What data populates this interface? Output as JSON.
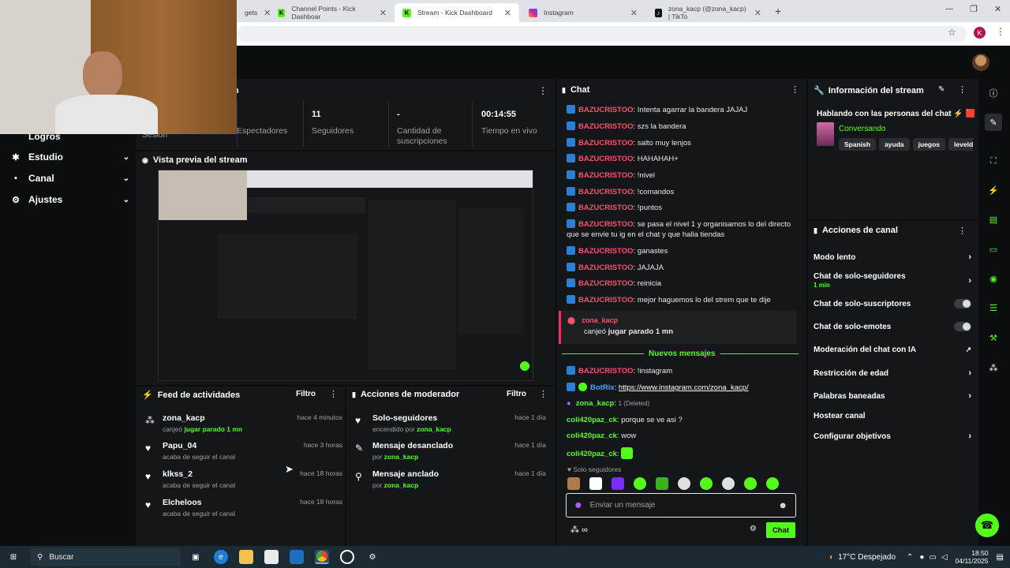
{
  "browser": {
    "tabs": [
      {
        "label": "gets",
        "active": false
      },
      {
        "label": "Channel Points - Kick Dashboar",
        "active": false
      },
      {
        "label": "Stream - Kick Dashboard",
        "active": true
      },
      {
        "label": "Instagram",
        "active": false
      },
      {
        "label": "zona_kacp (@zona_kacp) | TikTo",
        "active": false
      }
    ],
    "profile_initial": "K"
  },
  "sidebar": {
    "items": [
      {
        "label": "Logros",
        "icon": "trophy-icon"
      },
      {
        "label": "Estudio",
        "icon": "studio-icon"
      },
      {
        "label": "Canal",
        "icon": "channel-icon"
      },
      {
        "label": "Ajustes",
        "icon": "gear-icon"
      }
    ]
  },
  "stats": {
    "title_fragment": "n",
    "sesion_label": "Sesión",
    "items": [
      {
        "value": "",
        "label": "Espectadores"
      },
      {
        "value": "11",
        "label": "Seguidores"
      },
      {
        "value": "-",
        "label": "Cantidad de suscripciones"
      },
      {
        "value": "00:14:55",
        "label": "Tiempo en vivo"
      }
    ]
  },
  "preview": {
    "title": "Vista previa del stream"
  },
  "activity_feed": {
    "title": "Feed de actividades",
    "filter": "Filtro",
    "items": [
      {
        "name": "zona_kacp",
        "sub_prefix": "canjeó",
        "sub_highlight": "jugar parado 1 mn",
        "time": "hace 4 minutos",
        "icon": "redeem-icon"
      },
      {
        "name": "Papu_04",
        "sub_prefix": "acaba de seguir el canal",
        "sub_highlight": "",
        "time": "hace 3 horas",
        "icon": "heart-icon"
      },
      {
        "name": "klkss_2",
        "sub_prefix": "acaba de seguir el canal",
        "sub_highlight": "",
        "time": "hace 18 horas",
        "icon": "heart-icon"
      },
      {
        "name": "Elcheloos",
        "sub_prefix": "acaba de seguir el canal",
        "sub_highlight": "",
        "time": "hace 18 horas",
        "icon": "heart-icon"
      }
    ]
  },
  "mod_actions": {
    "title": "Acciones de moderador",
    "filter": "Filtro",
    "items": [
      {
        "name": "Solo-seguidores",
        "sub_prefix": "encendido por",
        "sub_highlight": "zona_kacp",
        "time": "hace 1 día",
        "icon": "heart-icon"
      },
      {
        "name": "Mensaje desanclado",
        "sub_prefix": "por",
        "sub_highlight": "zona_kacp",
        "time": "hace 1 día",
        "icon": "unpin-icon"
      },
      {
        "name": "Mensaje anclado",
        "sub_prefix": "por",
        "sub_highlight": "zona_kacp",
        "time": "hace 1 día",
        "icon": "pin-icon"
      }
    ]
  },
  "chat": {
    "title": "Chat",
    "messages": [
      {
        "user": "BAZUCRISTOO",
        "text": "Intenta agarrar la bandera JAJAJ"
      },
      {
        "user": "BAZUCRISTOO",
        "text": "szs la bandera"
      },
      {
        "user": "BAZUCRISTOO",
        "text": "salto muy lenjos"
      },
      {
        "user": "BAZUCRISTOO",
        "text": "HAHAHAH+"
      },
      {
        "user": "BAZUCRISTOO",
        "text": "!nivel"
      },
      {
        "user": "BAZUCRISTOO",
        "text": "!comandos"
      },
      {
        "user": "BAZUCRISTOO",
        "text": "!puntos"
      },
      {
        "user": "BAZUCRISTOO",
        "text": "se pasa el nivel 1 y organisamos lo del directo que se envie tu ig en el chat y que halla tiendas"
      },
      {
        "user": "BAZUCRISTOO",
        "text": "ganastes"
      },
      {
        "user": "BAZUCRISTOO",
        "text": "JAJAJA"
      },
      {
        "user": "BAZUCRISTOO",
        "text": "reinicia"
      },
      {
        "user": "BAZUCRISTOO",
        "text": "mejor haguemos lo del strem que te dije"
      }
    ],
    "redeem": {
      "user": "zona_kacp",
      "prefix": "canjeó",
      "reward": "jugar parado 1 mn"
    },
    "new_messages_label": "Nuevos mensajes",
    "messages2": [
      {
        "user": "BAZUCRISTOO",
        "text": "!instagram",
        "color": "#ff4d6d"
      },
      {
        "user": "BotRix",
        "text": "https://www.instagram.com/zona_kacp/",
        "color": "#4aa3ff"
      },
      {
        "user": "zona_kacp",
        "text": "1 (Deleted)",
        "color": "#53fc18"
      },
      {
        "user": "coli420paz_ck",
        "text": "porque se ve asi ?",
        "color": "#53fc18"
      },
      {
        "user": "coli420paz_ck",
        "text": "wow",
        "color": "#53fc18"
      },
      {
        "user": "coli420paz_ck",
        "text": "",
        "color": "#53fc18"
      }
    ],
    "mode_label": "Solo seguidores",
    "input_placeholder": "Enviar un mensaje",
    "send_label": "Chat"
  },
  "stream_info": {
    "title": "Información del stream",
    "stream_title": "Hablando con las personas del chat ⚡ 🟥",
    "category": "Conversando",
    "tags": [
      "Spanish",
      "ayuda",
      "juegos",
      "levelde"
    ]
  },
  "channel_actions": {
    "title": "Acciones de canal",
    "items": [
      {
        "label": "Modo lento",
        "control": "chevron",
        "sub": ""
      },
      {
        "label": "Chat de solo-seguidores",
        "control": "chevron",
        "sub": "1 min"
      },
      {
        "label": "Chat de solo-suscriptores",
        "control": "toggle",
        "sub": ""
      },
      {
        "label": "Chat de solo-emotes",
        "control": "toggle",
        "sub": ""
      },
      {
        "label": "Moderación del chat con IA",
        "control": "external",
        "sub": ""
      },
      {
        "label": "Restricción de edad",
        "control": "chevron",
        "sub": ""
      },
      {
        "label": "Palabras baneadas",
        "control": "chevron",
        "sub": ""
      },
      {
        "label": "Hostear canal",
        "control": "none",
        "sub": ""
      },
      {
        "label": "Configurar objetivos",
        "control": "chevron",
        "sub": ""
      }
    ]
  },
  "taskbar": {
    "search_placeholder": "Buscar",
    "weather": "17°C Despejado",
    "time": "18:50",
    "date": "04/11/2025"
  },
  "colors": {
    "accent": "#53fc18",
    "chat_user": "#ff4d6d",
    "bg": "#0b0e0f",
    "panel": "#141719"
  }
}
